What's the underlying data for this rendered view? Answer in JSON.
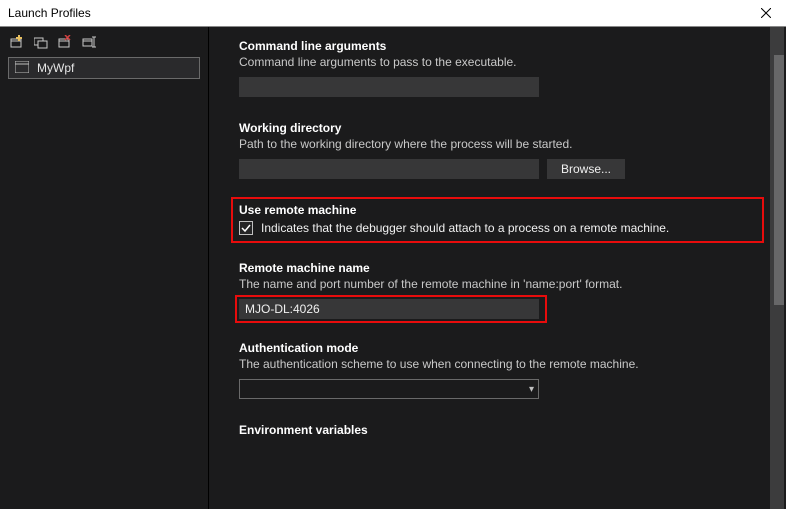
{
  "window": {
    "title": "Launch Profiles"
  },
  "sidebar": {
    "profile": {
      "label": "MyWpf"
    }
  },
  "sections": {
    "cmdline": {
      "title": "Command line arguments",
      "desc": "Command line arguments to pass to the executable.",
      "value": ""
    },
    "workdir": {
      "title": "Working directory",
      "desc": "Path to the working directory where the process will be started.",
      "value": "",
      "browse_label": "Browse..."
    },
    "remote": {
      "title": "Use remote machine",
      "checkbox_label": "Indicates that the debugger should attach to a process on a remote machine.",
      "checked": true
    },
    "remote_name": {
      "title": "Remote machine name",
      "desc": "The name and port number of the remote machine in 'name:port' format.",
      "value": "MJO-DL:4026"
    },
    "auth": {
      "title": "Authentication mode",
      "desc": "The authentication scheme to use when connecting to the remote machine.",
      "value": ""
    },
    "env": {
      "title": "Environment variables"
    }
  }
}
